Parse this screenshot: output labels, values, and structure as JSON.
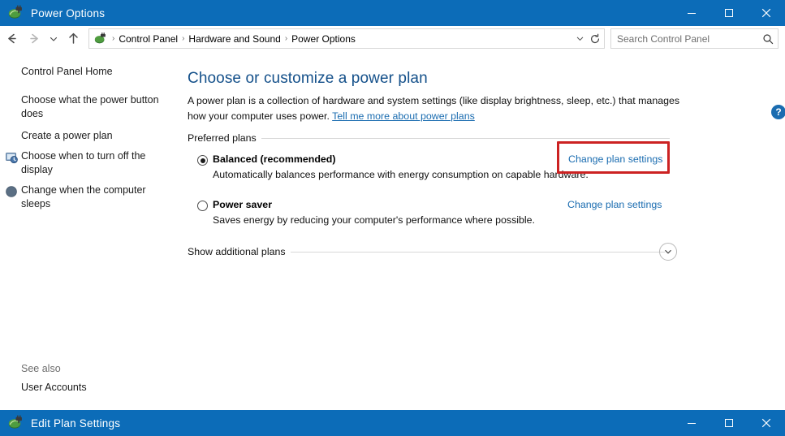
{
  "window": {
    "title": "Power Options",
    "icon": "power-plug-icon",
    "controls": {
      "minimize": "Minimize",
      "maximize": "Maximize",
      "close": "Close"
    },
    "accent_color": "#0c6cb8"
  },
  "toolbar": {
    "back": "Back",
    "forward": "Forward",
    "recent_locations": "Recent locations",
    "up": "Up one level",
    "breadcrumb_icon": "control-panel-icon",
    "breadcrumb": [
      "Control Panel",
      "Hardware and Sound",
      "Power Options"
    ],
    "separator": "›",
    "dropdown_caret": "⌄",
    "refresh": "Refresh",
    "search": {
      "value": "",
      "placeholder": "Search Control Panel",
      "icon": "search-icon"
    }
  },
  "sidebar": {
    "items": [
      {
        "label": "Control Panel Home",
        "icon": null
      },
      {
        "label": "Choose what the power button does",
        "icon": null
      },
      {
        "label": "Create a power plan",
        "icon": null
      },
      {
        "label": "Choose when to turn off the display",
        "icon": "display-clock-icon"
      },
      {
        "label": "Change when the computer sleeps",
        "icon": "sleep-moon-icon"
      }
    ],
    "see_also": {
      "heading": "See also",
      "items": [
        "User Accounts"
      ]
    }
  },
  "main": {
    "heading": "Choose or customize a power plan",
    "description_part1": "A power plan is a collection of hardware and system settings (like display brightness, sleep, etc.) that manages how your computer uses power. ",
    "description_link": "Tell me more about power plans",
    "group_label": "Preferred plans",
    "help_button": "?",
    "plans": [
      {
        "name": "Balanced (recommended)",
        "description": "Automatically balances performance with energy consumption on capable hardware.",
        "selected": true,
        "action": "Change plan settings",
        "highlighted": true
      },
      {
        "name": "Power saver",
        "description": "Saves energy by reducing your computer's performance where possible.",
        "selected": false,
        "action": "Change plan settings",
        "highlighted": false
      }
    ],
    "show_additional": {
      "label": "Show additional plans",
      "expander_icon": "chevron-down-icon"
    },
    "highlight_color": "#cc2222"
  },
  "bottom_window": {
    "title": "Edit Plan Settings",
    "icon": "power-plug-icon",
    "controls": {
      "minimize": "Minimize",
      "maximize": "Maximize",
      "close": "Close"
    }
  }
}
